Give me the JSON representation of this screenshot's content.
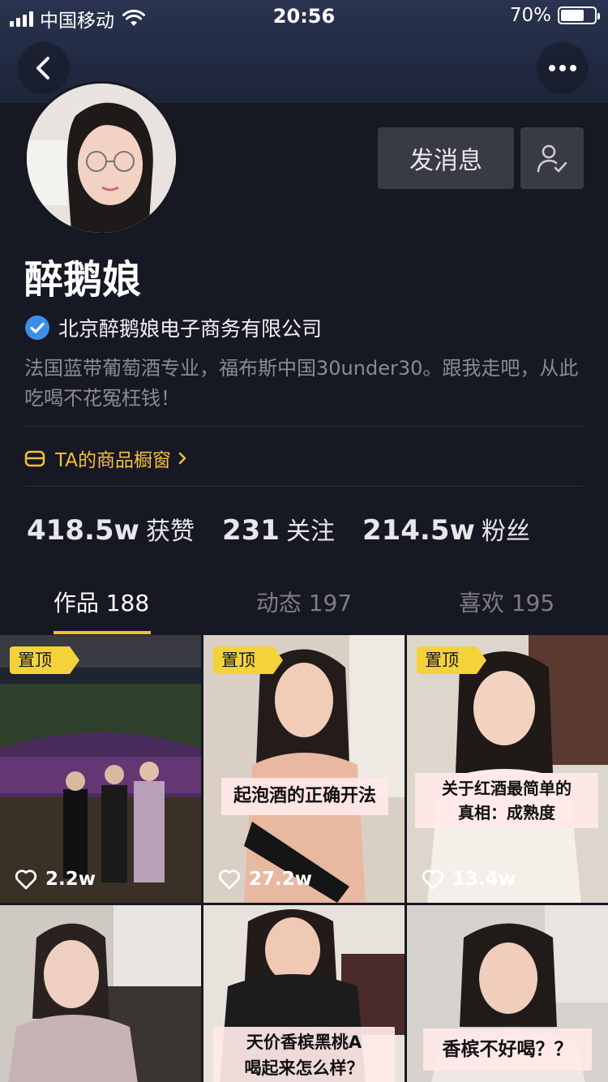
{
  "status_bar": {
    "carrier": "中国移动",
    "time": "20:56",
    "battery": "70%",
    "battery_level": 0.7
  },
  "header": {
    "back_icon": "chevron-left-icon",
    "more_icon": "ellipsis-icon"
  },
  "profile": {
    "name": "醉鹅娘",
    "verified_org": "北京醉鹅娘电子商务有限公司",
    "bio": "法国蓝带葡萄酒专业，福布斯中国30under30。跟我走吧，从此吃喝不花冤枉钱！",
    "shop_label": "TA的商品橱窗",
    "message_button": "发消息"
  },
  "stats": [
    {
      "value": "418.5w",
      "label": "获赞"
    },
    {
      "value": "231",
      "label": "关注"
    },
    {
      "value": "214.5w",
      "label": "粉丝"
    }
  ],
  "tabs": [
    {
      "label": "作品 188",
      "active": true
    },
    {
      "label": "动态 197",
      "active": false
    },
    {
      "label": "喜欢 195",
      "active": false
    }
  ],
  "videos": [
    {
      "pinned": "置顶",
      "likes": "2.2w",
      "caption": ""
    },
    {
      "pinned": "置顶",
      "likes": "27.2w",
      "caption": "起泡酒的正确开法"
    },
    {
      "pinned": "置顶",
      "likes": "13.4w",
      "caption": "关于红酒最简单的\n真相：成熟度"
    },
    {
      "pinned": "",
      "likes": "",
      "caption": ""
    },
    {
      "pinned": "",
      "likes": "",
      "caption": "天价香槟黑桃A\n喝起来怎么样？"
    },
    {
      "pinned": "",
      "likes": "",
      "caption": "香槟不好喝？？"
    }
  ],
  "colors": {
    "background": "#161823",
    "accent": "#f4c03a",
    "verify_blue": "#3a8ee6"
  }
}
